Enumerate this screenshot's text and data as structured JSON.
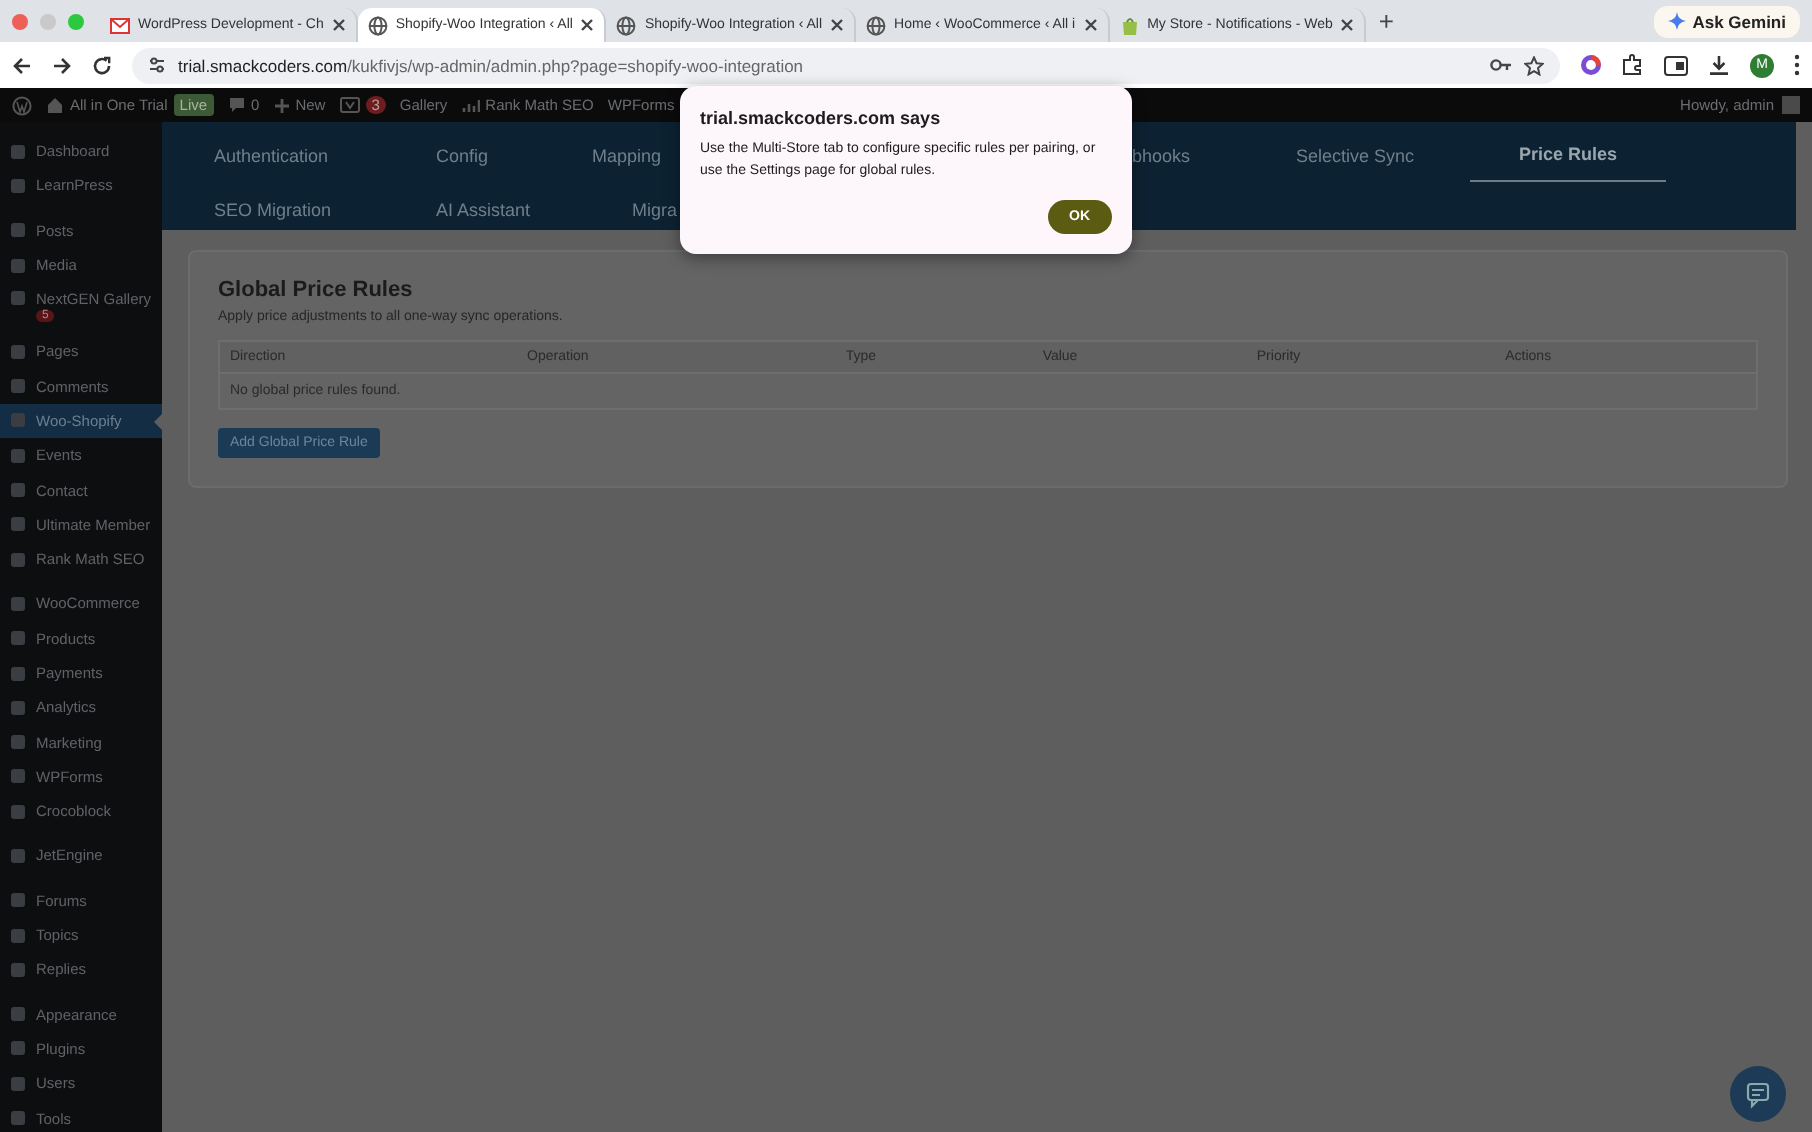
{
  "browser": {
    "tabs": [
      {
        "title": "WordPress Development - Ch",
        "kind": "mail",
        "selected": false
      },
      {
        "title": "Shopify-Woo Integration ‹ All",
        "kind": "globe",
        "selected": true
      },
      {
        "title": "Shopify-Woo Integration ‹ All",
        "kind": "globe",
        "selected": false
      },
      {
        "title": "Home ‹ WooCommerce ‹ All i",
        "kind": "globe",
        "selected": false
      },
      {
        "title": "My Store - Notifications - Web",
        "kind": "bag",
        "selected": false
      }
    ],
    "new_tab": "+",
    "ask_button": "Ask Gemini",
    "url": {
      "host": "trial.smackcoders.com",
      "path": "/kukfivjs/wp-admin/admin.php?page=shopify-woo-integration"
    },
    "profile": "M"
  },
  "admin_bar": {
    "site": "All in One Trial",
    "live_badge": "Live",
    "comments": "0",
    "new": "New",
    "updates": "3",
    "items": [
      "Gallery",
      "Rank Math SEO",
      "WPForms"
    ],
    "greeting": "Howdy, admin"
  },
  "sidebar": {
    "groups": [
      [
        {
          "label": "Dashboard",
          "selected": false
        },
        {
          "label": "LearnPress",
          "selected": false
        }
      ],
      [
        {
          "label": "Posts",
          "selected": false
        },
        {
          "label": "Media",
          "selected": false
        },
        {
          "label": "NextGEN Gallery",
          "selected": false,
          "badge": "5"
        },
        {
          "label": "Pages",
          "selected": false
        },
        {
          "label": "Comments",
          "selected": false
        },
        {
          "label": "Woo-Shopify",
          "selected": true
        },
        {
          "label": "Events",
          "selected": false
        },
        {
          "label": "Contact",
          "selected": false
        },
        {
          "label": "Ultimate Member",
          "selected": false
        },
        {
          "label": "Rank Math SEO",
          "selected": false
        }
      ],
      [
        {
          "label": "WooCommerce",
          "selected": false
        },
        {
          "label": "Products",
          "selected": false
        },
        {
          "label": "Payments",
          "selected": false
        },
        {
          "label": "Analytics",
          "selected": false
        },
        {
          "label": "Marketing",
          "selected": false
        },
        {
          "label": "WPForms",
          "selected": false
        },
        {
          "label": "Crocoblock",
          "selected": false
        }
      ],
      [
        {
          "label": "JetEngine",
          "selected": false
        }
      ],
      [
        {
          "label": "Forums",
          "selected": false
        },
        {
          "label": "Topics",
          "selected": false
        },
        {
          "label": "Replies",
          "selected": false
        }
      ],
      [
        {
          "label": "Appearance",
          "selected": false
        },
        {
          "label": "Plugins",
          "selected": false
        },
        {
          "label": "Users",
          "selected": false
        },
        {
          "label": "Tools",
          "selected": false
        }
      ]
    ]
  },
  "plugin_tabs": [
    [
      {
        "label": "Authentication",
        "selected": false
      },
      {
        "label": "Config",
        "selected": false
      },
      {
        "label": "Mapping",
        "selected": false
      },
      {
        "label": "bhooks",
        "selected": false
      },
      {
        "label": "Selective Sync",
        "selected": false
      },
      {
        "label": "Price Rules",
        "selected": true
      }
    ],
    [
      {
        "label": "SEO Migration",
        "selected": false
      },
      {
        "label": "AI Assistant",
        "selected": false
      },
      {
        "label": "Migra",
        "selected": false
      }
    ]
  ],
  "card": {
    "title": "Global Price Rules",
    "description": "Apply price adjustments to all one-way sync operations.",
    "table": {
      "columns": [
        "Direction",
        "Operation",
        "Type",
        "Value",
        "Priority",
        "Actions"
      ],
      "empty_message": "No global price rules found."
    },
    "add_button": "Add Global Price Rule"
  },
  "dialog": {
    "title": "trial.smackcoders.com says",
    "message": "Use the Multi-Store tab to configure specific rules per pairing, or use the Settings page for global rules.",
    "ok_button": "OK"
  }
}
